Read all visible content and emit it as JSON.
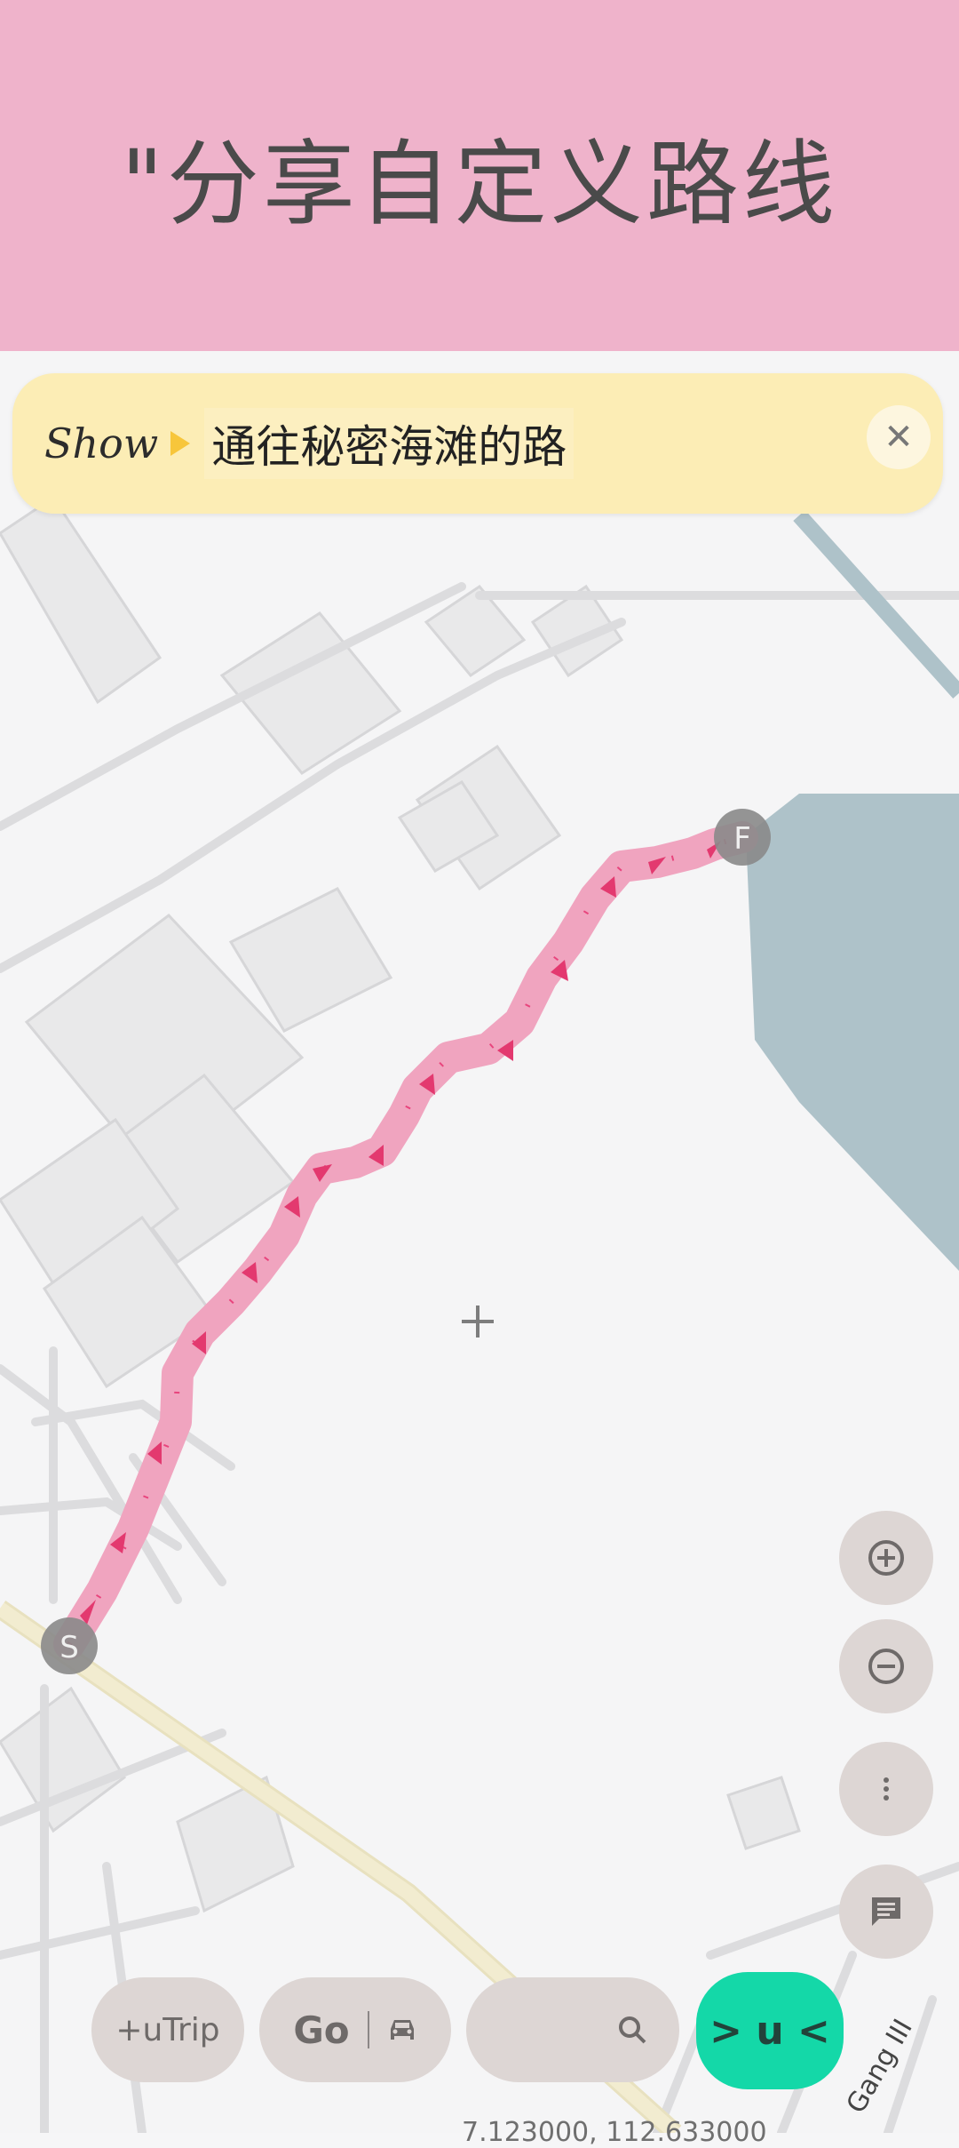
{
  "header": {
    "title": "\"分享自定义路线"
  },
  "banner": {
    "prefix": "Show",
    "route_name": "通往秘密海滩的路",
    "close_icon": "close-icon"
  },
  "map": {
    "start_marker": "S",
    "end_marker": "F",
    "street_label": "Gang III",
    "coordinates": "7.123000, 112.633000",
    "colors": {
      "route": "#e8457d",
      "water": "#aec2c9",
      "main_road": "#f2ecd0"
    }
  },
  "controls": {
    "zoom_in_icon": "zoom-in-icon",
    "zoom_out_icon": "zoom-out-icon",
    "more_icon": "more-vert-icon",
    "chat_icon": "chat-icon"
  },
  "bottom_bar": {
    "utrip_label": "+uTrip",
    "go_label": "Go",
    "car_icon": "car-icon",
    "search_icon": "search-icon",
    "main_label": "> u <"
  },
  "accent_color": "#14d8a8",
  "header_color": "#efb3cb",
  "banner_color": "#fcedb5"
}
